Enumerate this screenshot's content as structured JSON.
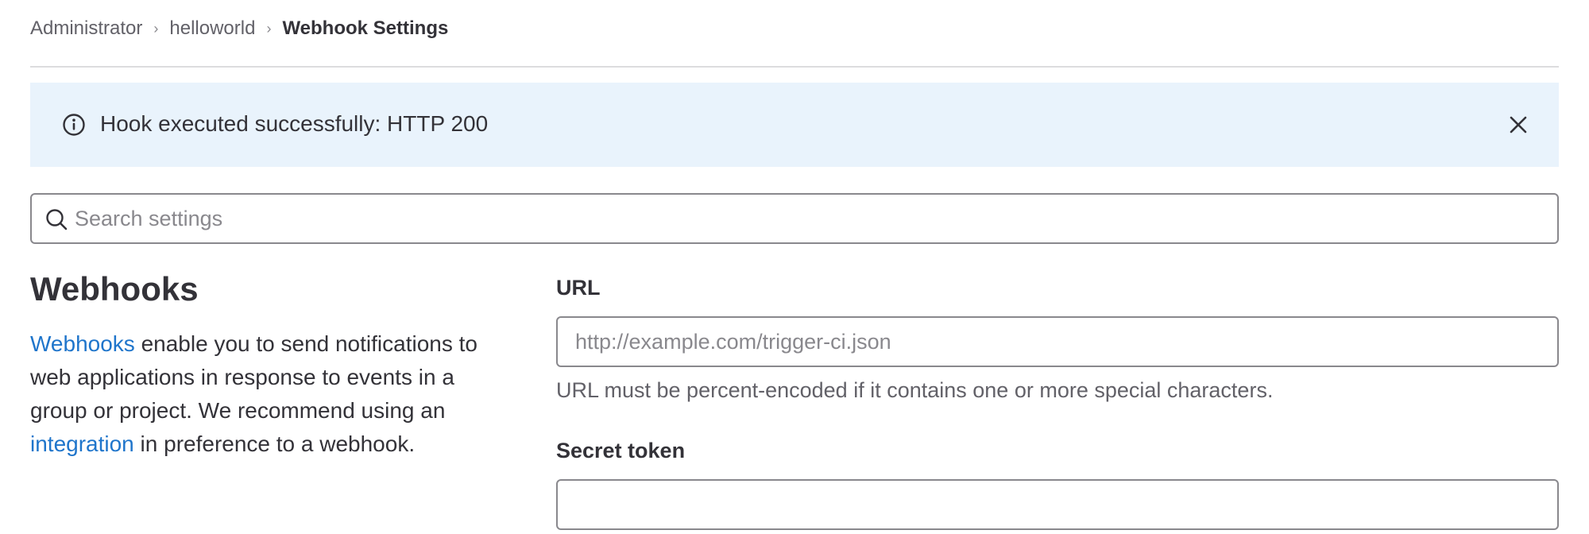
{
  "breadcrumb": {
    "items": [
      "Administrator",
      "helloworld"
    ],
    "current": "Webhook Settings"
  },
  "alert": {
    "message": "Hook executed successfully: HTTP 200",
    "icon": "info-circle-icon",
    "close_icon": "close-icon"
  },
  "search": {
    "placeholder": "Search settings",
    "value": "",
    "icon": "search-icon"
  },
  "section": {
    "title": "Webhooks",
    "desc_link1": "Webhooks",
    "desc_part1": " enable you to send notifications to web applications in response to events in a group or project. We recommend using an ",
    "desc_link2": "integration",
    "desc_part2": " in preference to a webhook."
  },
  "form": {
    "url_label": "URL",
    "url_placeholder": "http://example.com/trigger-ci.json",
    "url_value": "",
    "url_help": "URL must be percent-encoded if it contains one or more special characters.",
    "secret_label": "Secret token",
    "secret_value": ""
  },
  "colors": {
    "link": "#1f75cb",
    "alert_bg": "#e9f3fc",
    "text": "#333238",
    "muted": "#626168",
    "border": "#89888d"
  }
}
